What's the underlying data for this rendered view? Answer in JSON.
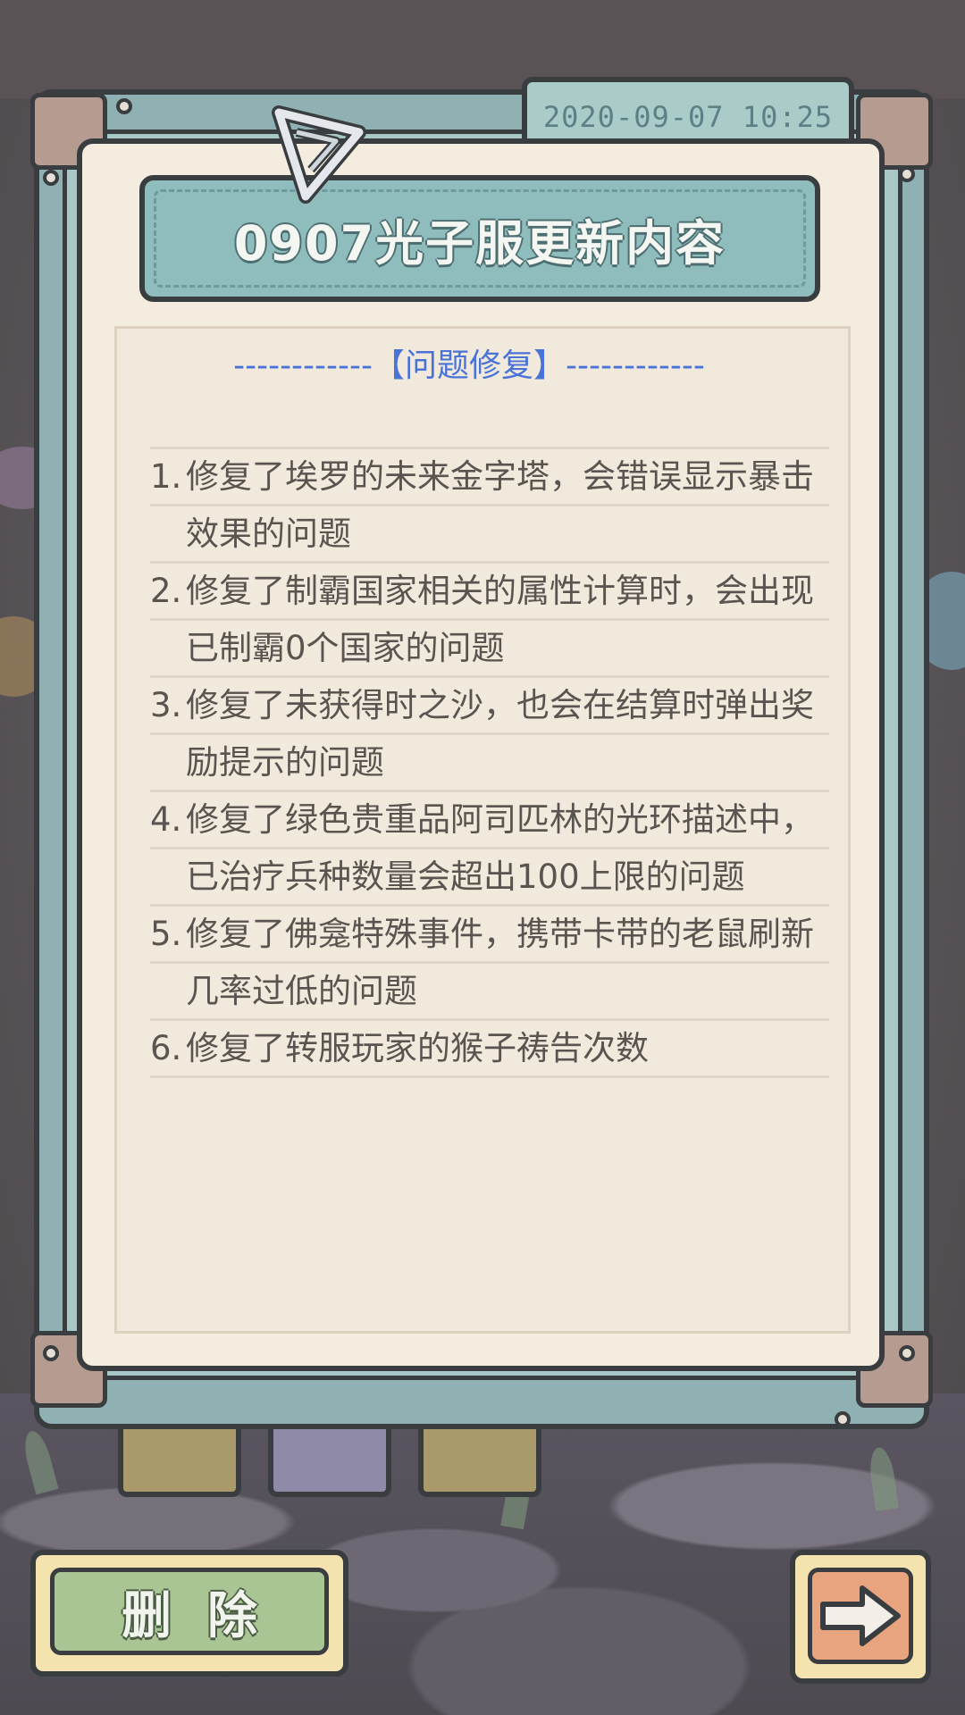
{
  "header": {
    "date": "2020-09-07  10:25",
    "title": "0907光子服更新内容"
  },
  "section": {
    "heading": "------------【问题修复】------------"
  },
  "notes": [
    {
      "num": "1.",
      "lines": [
        "修复了埃罗的未来金字塔，会错误显示暴击",
        "效果的问题"
      ]
    },
    {
      "num": "2.",
      "lines": [
        "修复了制霸国家相关的属性计算时，会出现",
        "已制霸0个国家的问题"
      ]
    },
    {
      "num": "3.",
      "lines": [
        "修复了未获得时之沙，也会在结算时弹出奖",
        "励提示的问题"
      ]
    },
    {
      "num": "4.",
      "lines": [
        "修复了绿色贵重品阿司匹林的光环描述中，",
        "已治疗兵种数量会超出100上限的问题"
      ]
    },
    {
      "num": "5.",
      "lines": [
        "修复了佛龛特殊事件，携带卡带的老鼠刷新",
        "几率过低的问题"
      ]
    },
    {
      "num": "6.",
      "lines": [
        "修复了转服玩家的猴子祷告次数"
      ]
    }
  ],
  "buttons": {
    "delete_label": "删除",
    "next_icon": "arrow-right-icon"
  },
  "colors": {
    "frame": "#8fb1b3",
    "paper": "#f3ecdf",
    "heading_blue": "#4a73d8",
    "delete_green": "#a8c593",
    "next_orange": "#e8a47e"
  }
}
